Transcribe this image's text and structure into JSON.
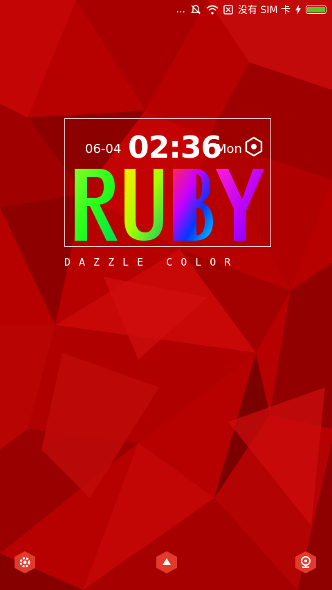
{
  "status_bar": {
    "dots": "...",
    "carrier_text": "没有 SIM 卡",
    "icons": [
      "more-dots-icon",
      "bell-muted-icon",
      "wifi-icon",
      "sim-missing-icon",
      "charging-icon",
      "battery-icon"
    ],
    "battery_level": 1.0,
    "battery_color": "#53c62b"
  },
  "widget": {
    "date": "06-04",
    "time": "02:36",
    "weekday": "Mon",
    "logo_text": "RUBY",
    "tagline": "DAZZLE COLOR",
    "settings_icon": "hexagon-settings-icon"
  },
  "dock": {
    "left_icon": "gear-icon",
    "center_icon": "up-arrow-icon",
    "right_icon": "camera-icon",
    "button_color": "#e23a2c"
  },
  "colors": {
    "background": "#b30000"
  }
}
